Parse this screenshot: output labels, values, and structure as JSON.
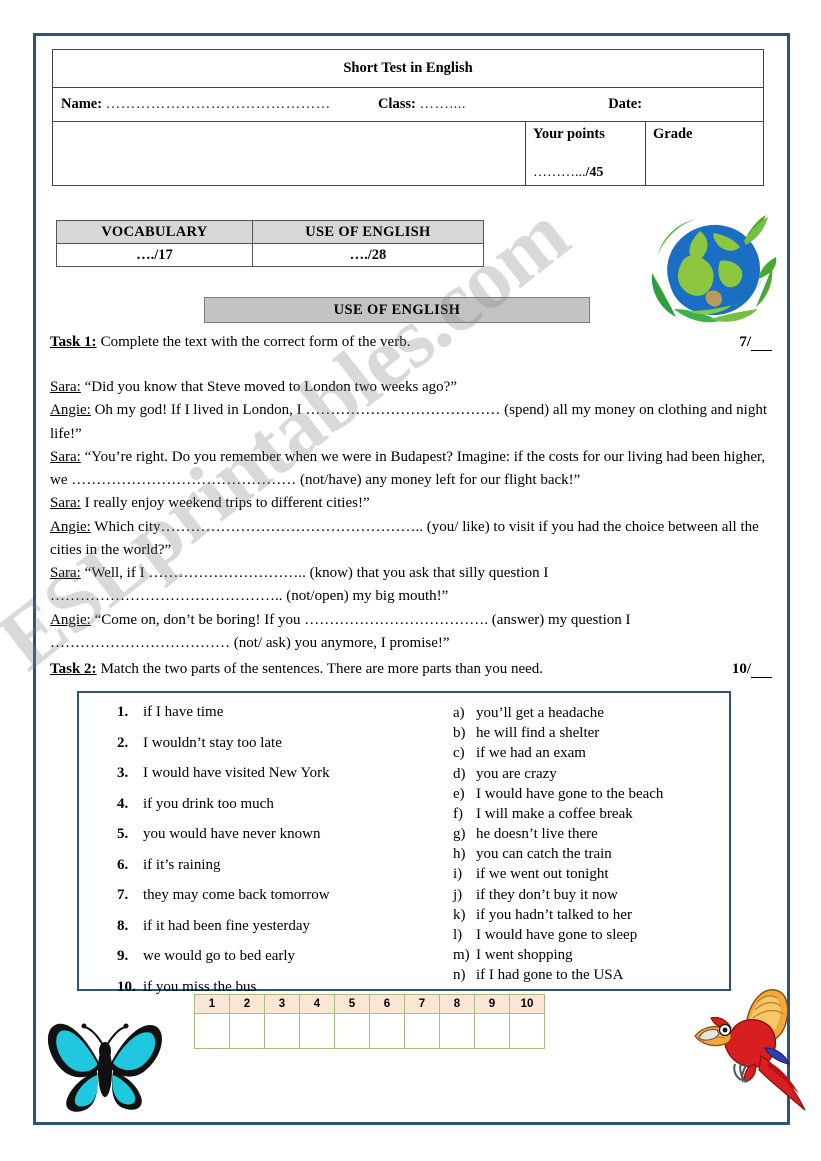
{
  "page": {
    "watermark": "ESLprintables.com"
  },
  "header": {
    "title": "Short Test in English",
    "name_label": "Name:",
    "name_dots": "………………………………………",
    "class_label": "Class:",
    "class_dots": "……....",
    "date_label": "Date:",
    "points_label": "Your points",
    "points_value_dots": "………...",
    "points_total": "/45",
    "grade_label": "Grade"
  },
  "score_table": {
    "headers": [
      "VOCABULARY",
      "USE OF ENGLISH"
    ],
    "values": [
      "…./17",
      "…./28"
    ]
  },
  "section_banner": "USE OF ENGLISH",
  "task1": {
    "label": "Task 1:",
    "description": "Complete the text with the correct form of the verb.",
    "score": "7/",
    "lines": [
      {
        "speaker": "Sara:",
        "text": " “Did you know that Steve moved to London two weeks ago?”"
      },
      {
        "speaker": "Angie:",
        "text": " Oh my god! If I lived in London, I ………………………………… (spend) all my money on clothing and night life!”"
      },
      {
        "speaker": "Sara:",
        "text": " “You’re right. Do you remember when we were in Budapest? Imagine: if the costs for our living had been higher, we ……………………………………… (not/have) any money left for our flight back!”"
      },
      {
        "speaker": "Sara:",
        "text": " I really enjoy weekend trips to different cities!”"
      },
      {
        "speaker": "Angie:",
        "text": " Which city…………………………………………….. (you/ like) to visit if you had the choice between all the cities in the world?”"
      },
      {
        "speaker": "Sara:",
        "text": " “Well, if I ………………………….. (know) that you ask that silly question I ……………………………………….. (not/open)  my big mouth!”"
      },
      {
        "speaker": "Angie:",
        "text": " “Come on, don’t be boring! If you ………………………………. (answer) my question I ………………………………  (not/ ask) you anymore, I promise!”"
      }
    ]
  },
  "task2": {
    "label": "Task 2:",
    "description": "Match the two parts of the sentences. There are more parts than you need.",
    "score": "10/",
    "left_items": [
      {
        "num": "1.",
        "text": "if I have time"
      },
      {
        "num": "2.",
        "text": "I wouldn’t stay too late"
      },
      {
        "num": "3.",
        "text": "I would have visited New York"
      },
      {
        "num": "4.",
        "text": "if you drink too much"
      },
      {
        "num": "5.",
        "text": "you would have never known"
      },
      {
        "num": "6.",
        "text": "if it’s raining"
      },
      {
        "num": "7.",
        "text": "they may come back tomorrow"
      },
      {
        "num": "8.",
        "text": "if it had been fine yesterday"
      },
      {
        "num": "9.",
        "text": "we would go to bed early"
      },
      {
        "num": "10.",
        "text": "if you miss the bus"
      }
    ],
    "right_items": [
      {
        "letter": "a)",
        "text": "you’ll get a headache"
      },
      {
        "letter": "b)",
        "text": "he will find a shelter"
      },
      {
        "letter": "c)",
        "text": "if we had an exam"
      },
      {
        "letter": "d)",
        "text": "you are crazy"
      },
      {
        "letter": "e)",
        "text": "I would have gone to the beach"
      },
      {
        "letter": "f)",
        "text": "I will make a coffee break"
      },
      {
        "letter": "g)",
        "text": "he doesn’t live there"
      },
      {
        "letter": "h)",
        "text": "you can catch the train"
      },
      {
        "letter": "i)",
        "text": "if we went out tonight"
      },
      {
        "letter": "j)",
        "text": "if they don’t buy it now"
      },
      {
        "letter": "k)",
        "text": "if you hadn’t talked to her"
      },
      {
        "letter": "l)",
        "text": "I would have gone to sleep"
      },
      {
        "letter": "m)",
        "text": "I went shopping"
      },
      {
        "letter": "n)",
        "text": "if I had gone to the USA"
      }
    ],
    "answer_grid": {
      "headers": [
        "1",
        "2",
        "3",
        "4",
        "5",
        "6",
        "7",
        "8",
        "9",
        "10"
      ],
      "answers": [
        "",
        "",
        "",
        "",
        "",
        "",
        "",
        "",
        "",
        ""
      ]
    }
  },
  "decorations": [
    {
      "name": "eco-globe-image",
      "colors": [
        "#1a6fc4",
        "#7ac143",
        "#2e9e3e"
      ]
    },
    {
      "name": "butterfly-image",
      "colors": [
        "#1fc8de",
        "#111111"
      ]
    },
    {
      "name": "parrot-image",
      "colors": [
        "#d81f1f",
        "#f0a93c",
        "#2e3fb0"
      ]
    }
  ],
  "theme": {
    "page_border": "#2f5279",
    "banner_bg": "#c3c3c3",
    "table_head_bg": "#d7d7d7",
    "grid_head_bg": "#fae6d5",
    "grid_border": "#a3bd84"
  }
}
